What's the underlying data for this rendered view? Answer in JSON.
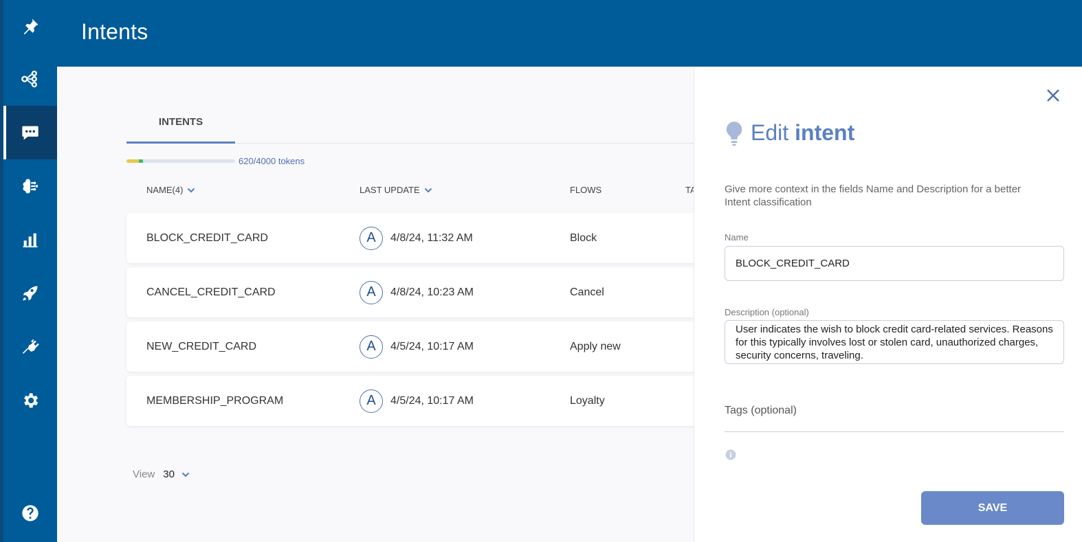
{
  "header": {
    "title": "Intents"
  },
  "sidebar": {
    "items": [
      {
        "icon": "pin-icon",
        "active": false
      },
      {
        "icon": "flow-graph-icon",
        "active": false
      },
      {
        "icon": "chat-bubble-icon",
        "active": true
      },
      {
        "icon": "brain-icon",
        "active": false
      },
      {
        "icon": "bar-chart-icon",
        "active": false
      },
      {
        "icon": "rocket-icon",
        "active": false
      },
      {
        "icon": "plug-icon",
        "active": false
      },
      {
        "icon": "gear-icon",
        "active": false
      },
      {
        "icon": "help-icon",
        "active": false
      }
    ]
  },
  "main": {
    "tab_label": "INTENTS",
    "tokens": {
      "label": "620/4000 tokens",
      "used": 620,
      "total": 4000
    },
    "columns": {
      "name": "NAME(4)",
      "last_update": "LAST UPDATE",
      "flows": "FLOWS",
      "tags": "TA"
    },
    "rows": [
      {
        "name": "BLOCK_CREDIT_CARD",
        "avatar": "A",
        "last_update": "4/8/24, 11:32 AM",
        "flow": "Block"
      },
      {
        "name": "CANCEL_CREDIT_CARD",
        "avatar": "A",
        "last_update": "4/8/24, 10:23 AM",
        "flow": "Cancel"
      },
      {
        "name": "NEW_CREDIT_CARD",
        "avatar": "A",
        "last_update": "4/5/24, 10:17 AM",
        "flow": "Apply new"
      },
      {
        "name": "MEMBERSHIP_PROGRAM",
        "avatar": "A",
        "last_update": "4/5/24, 10:17 AM",
        "flow": "Loyalty"
      }
    ],
    "view": {
      "label": "View",
      "value": "30"
    }
  },
  "panel": {
    "title_prefix": "Edit",
    "title_emphasis": "intent",
    "help_text": "Give more context in the fields Name and Description for a better Intent classification",
    "name_label": "Name",
    "name_value": "BLOCK_CREDIT_CARD",
    "description_label": "Description (optional)",
    "description_value": "User indicates the wish to block credit card-related services. Reasons for this typically involves lost or stolen card, unauthorized charges, security concerns, traveling.",
    "tags_label": "Tags (optional)",
    "save_label": "SAVE"
  },
  "colors": {
    "brand": "#005b99",
    "accent": "#5b80c4",
    "save_button": "#6a89c8",
    "token_yellow": "#e8c84a",
    "token_green": "#3dba7a"
  }
}
